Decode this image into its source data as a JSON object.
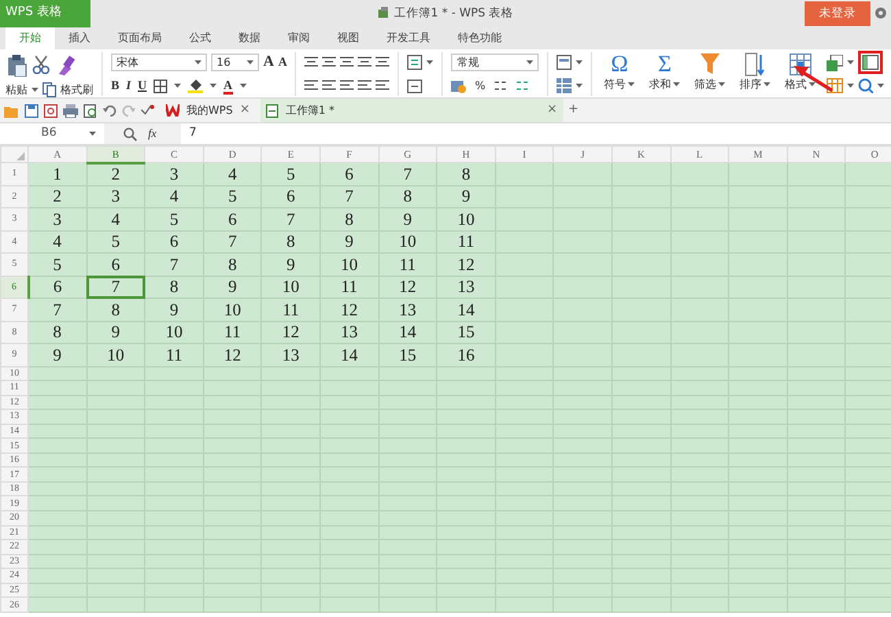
{
  "app": {
    "menu_label": "WPS 表格",
    "title": "工作簿1 * - WPS 表格",
    "login": "未登录"
  },
  "ribbon_tabs": [
    {
      "label": "开始",
      "selected": true
    },
    {
      "label": "插入",
      "selected": false
    },
    {
      "label": "页面布局",
      "selected": false
    },
    {
      "label": "公式",
      "selected": false
    },
    {
      "label": "数据",
      "selected": false
    },
    {
      "label": "审阅",
      "selected": false
    },
    {
      "label": "视图",
      "selected": false
    },
    {
      "label": "开发工具",
      "selected": false
    },
    {
      "label": "特色功能",
      "selected": false
    }
  ],
  "ribbon": {
    "paste": "粘贴",
    "format_painter": "格式刷",
    "font": "宋体",
    "font_size": "16",
    "grow_font": "A",
    "shrink_font": "A",
    "bold": "B",
    "italic": "I",
    "underline": "U",
    "font_color": "A",
    "number_format": "常规",
    "percent": "%",
    "tools": [
      {
        "kind": "symbol",
        "glyph": "Ω",
        "label": "符号"
      },
      {
        "kind": "sum",
        "glyph": "Σ",
        "label": "求和"
      },
      {
        "kind": "filter",
        "label": "筛选"
      },
      {
        "kind": "sort",
        "label": "排序"
      },
      {
        "kind": "format",
        "label": "格式"
      }
    ]
  },
  "doc_tabs": [
    {
      "label": "我的WPS",
      "selected": false,
      "close": "×"
    },
    {
      "label": "工作簿1 *",
      "selected": true,
      "close": "×"
    }
  ],
  "new_tab": "+",
  "formula_bar": {
    "cell_ref": "B6",
    "fx": "fx",
    "value": "7"
  },
  "sheet": {
    "columns": [
      {
        "label": "A",
        "selected": false
      },
      {
        "label": "B",
        "selected": true
      },
      {
        "label": "C",
        "selected": false
      },
      {
        "label": "D",
        "selected": false
      },
      {
        "label": "E",
        "selected": false
      },
      {
        "label": "F",
        "selected": false
      },
      {
        "label": "G",
        "selected": false
      },
      {
        "label": "H",
        "selected": false
      },
      {
        "label": "I",
        "selected": false
      },
      {
        "label": "J",
        "selected": false
      },
      {
        "label": "K",
        "selected": false
      },
      {
        "label": "L",
        "selected": false
      },
      {
        "label": "M",
        "selected": false
      },
      {
        "label": "N",
        "selected": false
      },
      {
        "label": "O",
        "selected": false
      }
    ],
    "rows": [
      {
        "label": "1",
        "selected": false,
        "cells": [
          "1",
          "2",
          "3",
          "4",
          "5",
          "6",
          "7",
          "8"
        ]
      },
      {
        "label": "2",
        "selected": false,
        "cells": [
          "2",
          "3",
          "4",
          "5",
          "6",
          "7",
          "8",
          "9"
        ]
      },
      {
        "label": "3",
        "selected": false,
        "cells": [
          "3",
          "4",
          "5",
          "6",
          "7",
          "8",
          "9",
          "10"
        ]
      },
      {
        "label": "4",
        "selected": false,
        "cells": [
          "4",
          "5",
          "6",
          "7",
          "8",
          "9",
          "10",
          "11"
        ]
      },
      {
        "label": "5",
        "selected": false,
        "cells": [
          "5",
          "6",
          "7",
          "8",
          "9",
          "10",
          "11",
          "12"
        ]
      },
      {
        "label": "6",
        "selected": true,
        "cells": [
          "6",
          "7",
          "8",
          "9",
          "10",
          "11",
          "12",
          "13"
        ]
      },
      {
        "label": "7",
        "selected": false,
        "cells": [
          "7",
          "8",
          "9",
          "10",
          "11",
          "12",
          "13",
          "14"
        ]
      },
      {
        "label": "8",
        "selected": false,
        "cells": [
          "8",
          "9",
          "10",
          "11",
          "12",
          "13",
          "14",
          "15"
        ]
      },
      {
        "label": "9",
        "selected": false,
        "cells": [
          "9",
          "10",
          "11",
          "12",
          "13",
          "14",
          "15",
          "16"
        ]
      },
      {
        "label": "10",
        "selected": false,
        "cells": []
      },
      {
        "label": "11",
        "selected": false,
        "cells": []
      },
      {
        "label": "12",
        "selected": false,
        "cells": []
      },
      {
        "label": "13",
        "selected": false,
        "cells": []
      },
      {
        "label": "14",
        "selected": false,
        "cells": []
      },
      {
        "label": "15",
        "selected": false,
        "cells": []
      },
      {
        "label": "16",
        "selected": false,
        "cells": []
      },
      {
        "label": "17",
        "selected": false,
        "cells": []
      },
      {
        "label": "18",
        "selected": false,
        "cells": []
      },
      {
        "label": "19",
        "selected": false,
        "cells": []
      },
      {
        "label": "20",
        "selected": false,
        "cells": []
      },
      {
        "label": "21",
        "selected": false,
        "cells": []
      },
      {
        "label": "22",
        "selected": false,
        "cells": []
      },
      {
        "label": "23",
        "selected": false,
        "cells": []
      },
      {
        "label": "24",
        "selected": false,
        "cells": []
      },
      {
        "label": "25",
        "selected": false,
        "cells": []
      },
      {
        "label": "26",
        "selected": false,
        "cells": []
      }
    ]
  }
}
